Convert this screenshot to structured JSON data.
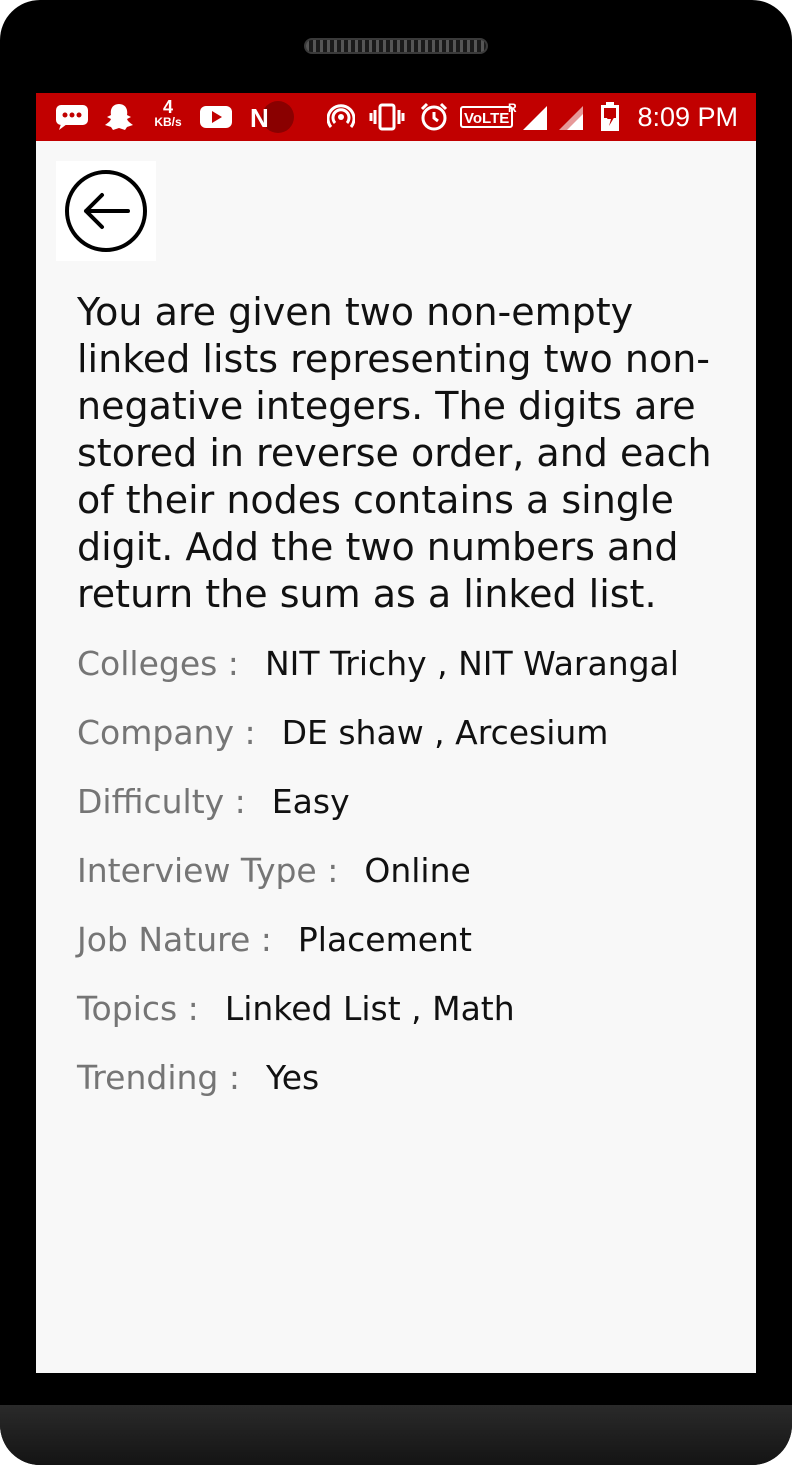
{
  "status_bar": {
    "net_speed_value": "4",
    "net_speed_unit": "KB/s",
    "network_type": "VoLTE",
    "roaming": "R",
    "time": "8:09 PM",
    "icons": [
      "messages-icon",
      "snapchat-icon",
      "net-speed",
      "youtube-icon",
      "n-app-icon",
      "hotspot-icon",
      "vibrate-icon",
      "alarm-icon",
      "volte-icon",
      "signal-icon",
      "signal-icon",
      "battery-icon"
    ]
  },
  "back_button": {
    "icon": "back-arrow-icon"
  },
  "question": {
    "description": "You are given two non-empty linked lists representing two non-negative integers. The digits are stored in reverse order, and each of their nodes contains a single digit. Add the two numbers and return the sum as a linked list."
  },
  "details": [
    {
      "label": "Colleges :",
      "value": "NIT Trichy , NIT Warangal"
    },
    {
      "label": "Company :",
      "value": "DE shaw , Arcesium"
    },
    {
      "label": "Difficulty :",
      "value": "Easy"
    },
    {
      "label": "Interview Type :",
      "value": "Online"
    },
    {
      "label": "Job Nature :",
      "value": "Placement"
    },
    {
      "label": "Topics :",
      "value": "Linked List , Math"
    },
    {
      "label": "Trending :",
      "value": "Yes"
    }
  ],
  "colors": {
    "status_bar": "#c10000",
    "background": "#f8f8f8",
    "label": "#757575",
    "text": "#111111"
  }
}
